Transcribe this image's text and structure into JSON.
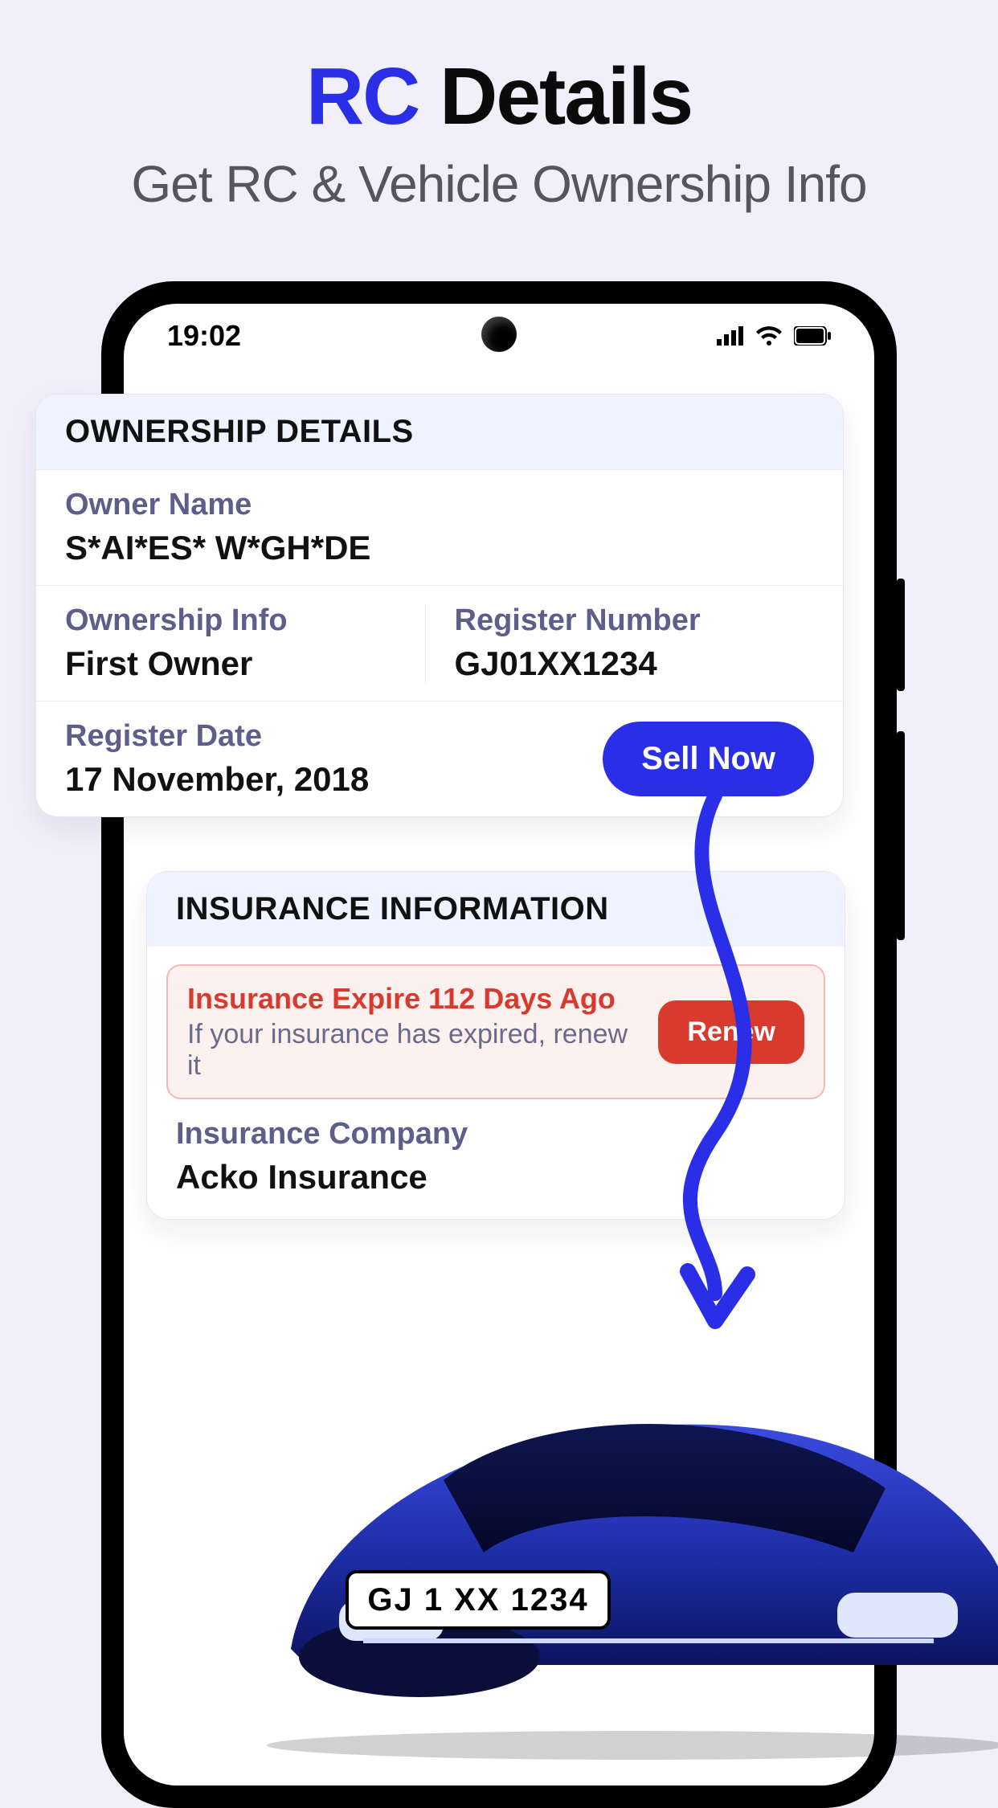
{
  "hero": {
    "title_accent": "RC",
    "title_rest": " Details",
    "subtitle": "Get RC & Vehicle Ownership Info"
  },
  "statusbar": {
    "time": "19:02"
  },
  "ownership": {
    "heading": "OWNERSHIP DETAILS",
    "owner_name_label": "Owner Name",
    "owner_name": "S*AI*ES* W*GH*DE",
    "ownership_info_label": "Ownership Info",
    "ownership_info": "First Owner",
    "register_number_label": "Register Number",
    "register_number": "GJ01XX1234",
    "register_date_label": "Register Date",
    "register_date": "17 November, 2018",
    "sell_button": "Sell Now"
  },
  "insurance": {
    "heading": "INSURANCE INFORMATION",
    "expired_title": "Insurance Expire 112 Days Ago",
    "expired_sub": "If your insurance has expired, renew it",
    "renew_button": "Renew",
    "company_label": "Insurance Company",
    "company": "Acko Insurance"
  },
  "car": {
    "plate": "GJ 1 XX 1234"
  },
  "colors": {
    "accent": "#2a2ee6",
    "danger": "#d83a2e",
    "label": "#5d5e8a"
  }
}
